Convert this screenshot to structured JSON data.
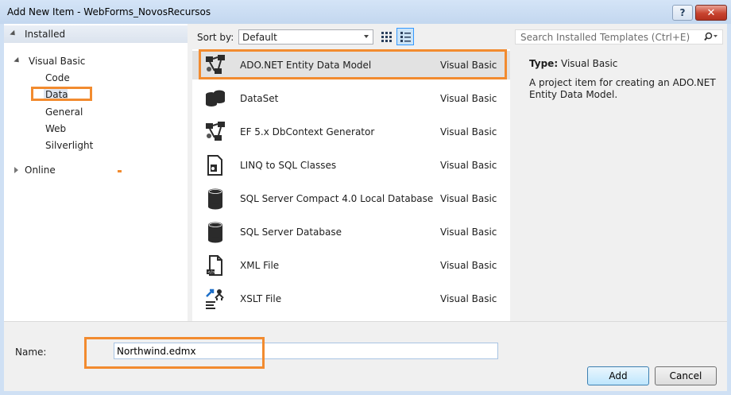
{
  "window": {
    "title": "Add New Item - WebForms_NovosRecursos",
    "help_label": "?",
    "close_label": "✕"
  },
  "sidebar": {
    "installed_label": "Installed",
    "language_label": "Visual Basic",
    "items": [
      {
        "label": "Code"
      },
      {
        "label": "Data"
      },
      {
        "label": "General"
      },
      {
        "label": "Web"
      },
      {
        "label": "Silverlight"
      }
    ],
    "online_label": "Online"
  },
  "toolbar": {
    "sort_label": "Sort by:",
    "sort_value": "Default"
  },
  "search": {
    "placeholder": "Search Installed Templates (Ctrl+E)"
  },
  "templates": [
    {
      "name": "ADO.NET Entity Data Model",
      "language": "Visual Basic",
      "icon": "entity-model-icon"
    },
    {
      "name": "DataSet",
      "language": "Visual Basic",
      "icon": "dataset-icon"
    },
    {
      "name": "EF 5.x DbContext Generator",
      "language": "Visual Basic",
      "icon": "entity-model-icon"
    },
    {
      "name": "LINQ to SQL Classes",
      "language": "Visual Basic",
      "icon": "linq-to-sql-icon"
    },
    {
      "name": "SQL Server Compact 4.0 Local Database",
      "language": "Visual Basic",
      "icon": "database-icon"
    },
    {
      "name": "SQL Server Database",
      "language": "Visual Basic",
      "icon": "database-icon"
    },
    {
      "name": "XML File",
      "language": "Visual Basic",
      "icon": "xml-file-icon"
    },
    {
      "name": "XSLT File",
      "language": "Visual Basic",
      "icon": "xslt-file-icon"
    }
  ],
  "details": {
    "type_label": "Type:",
    "type_value": "Visual Basic",
    "description": "A project item for creating an ADO.NET Entity Data Model."
  },
  "footer": {
    "name_label": "Name:",
    "name_value": "Northwind.edmx",
    "add_label": "Add",
    "cancel_label": "Cancel"
  },
  "colors": {
    "highlight": "#f28b2f",
    "selection": "#e2e2e2",
    "window_frame": "#cfe0f4"
  }
}
